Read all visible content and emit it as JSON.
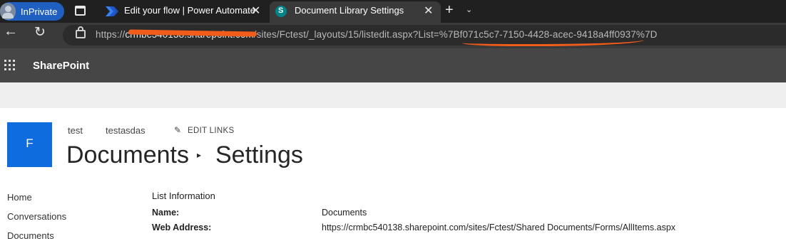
{
  "browser": {
    "inprivate_label": "InPrivate",
    "tabs": [
      {
        "title": "Edit your flow | Power Automate"
      },
      {
        "title": "Document Library Settings"
      }
    ],
    "url_host": "crmbc540138.sharepoint.com",
    "url_path": "/sites/Fctest/_layouts/15/listedit.aspx?List=%7Bf071c5c7-7150-4428-acec-9418a4ff0937%7D",
    "redaction_color": "#f25c1a"
  },
  "suite": {
    "brand": "SharePoint",
    "bar_color": "#464646"
  },
  "site": {
    "logo_letter": "F",
    "logo_color": "#0f6cde",
    "top_nav": [
      "test",
      "testasdas"
    ],
    "edit_links": "EDIT LINKS",
    "title_part1": "Documents",
    "separator": "▸",
    "title_part2": "Settings"
  },
  "quick_launch": [
    "Home",
    "Conversations",
    "Documents"
  ],
  "list_information": {
    "header": "List Information",
    "rows": [
      {
        "label": "Name:",
        "value": "Documents"
      },
      {
        "label": "Web Address:",
        "value": "https://crmbc540138.sharepoint.com/sites/Fctest/Shared Documents/Forms/AllItems.aspx"
      }
    ]
  }
}
